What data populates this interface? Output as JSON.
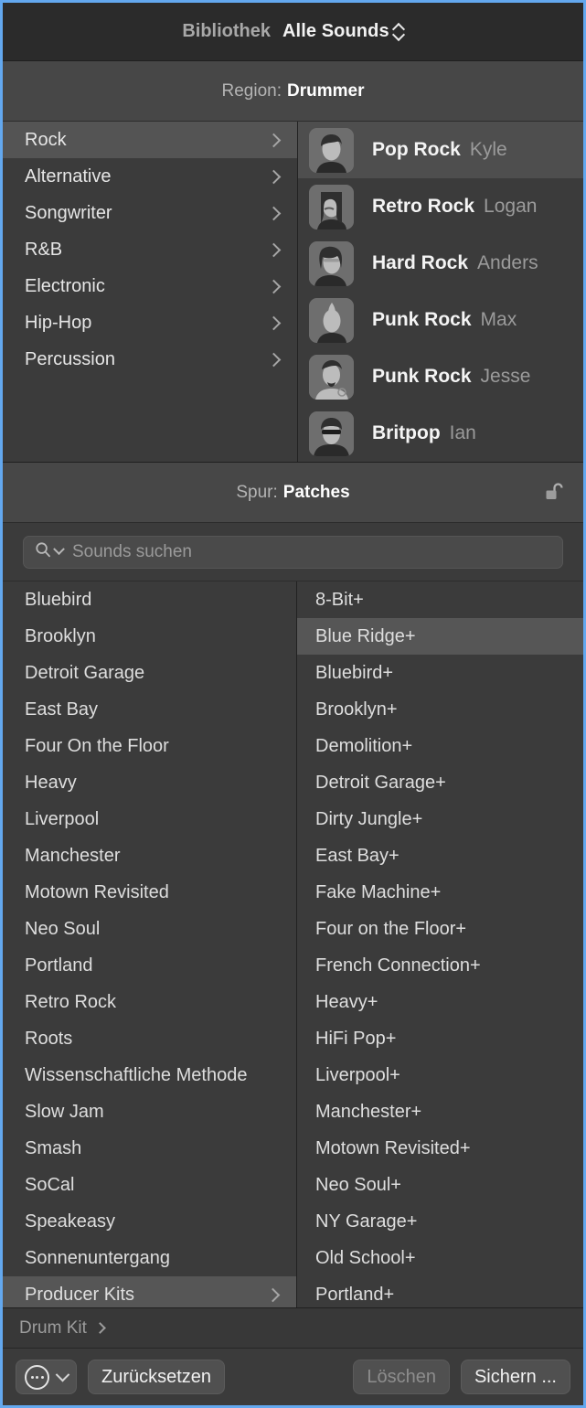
{
  "titlebar": {
    "library_label": "Bibliothek",
    "scope_label": "Alle Sounds",
    "scope_icon": "up-down-chevron-icon"
  },
  "region_header": {
    "prefix": "Region:",
    "value": "Drummer"
  },
  "genres": [
    {
      "label": "Rock",
      "selected": true
    },
    {
      "label": "Alternative",
      "selected": false
    },
    {
      "label": "Songwriter",
      "selected": false
    },
    {
      "label": "R&B",
      "selected": false
    },
    {
      "label": "Electronic",
      "selected": false
    },
    {
      "label": "Hip-Hop",
      "selected": false
    },
    {
      "label": "Percussion",
      "selected": false
    }
  ],
  "drummers": [
    {
      "style": "Pop Rock",
      "name": "Kyle",
      "selected": true,
      "avatar": "avatar-kyle"
    },
    {
      "style": "Retro Rock",
      "name": "Logan",
      "selected": false,
      "avatar": "avatar-logan"
    },
    {
      "style": "Hard Rock",
      "name": "Anders",
      "selected": false,
      "avatar": "avatar-anders"
    },
    {
      "style": "Punk Rock",
      "name": "Max",
      "selected": false,
      "avatar": "avatar-max"
    },
    {
      "style": "Punk Rock",
      "name": "Jesse",
      "selected": false,
      "avatar": "avatar-jesse"
    },
    {
      "style": "Britpop",
      "name": "Ian",
      "selected": false,
      "avatar": "avatar-ian"
    }
  ],
  "track_header": {
    "prefix": "Spur:",
    "value": "Patches",
    "lock_icon": "unlocked-padlock-icon"
  },
  "search": {
    "placeholder": "Sounds suchen",
    "value": "",
    "icon": "search-icon",
    "menu_icon": "chevron-down-icon"
  },
  "patches_left": [
    {
      "label": "Bluebird",
      "selected": false,
      "has_submenu": false
    },
    {
      "label": "Brooklyn",
      "selected": false,
      "has_submenu": false
    },
    {
      "label": "Detroit Garage",
      "selected": false,
      "has_submenu": false
    },
    {
      "label": "East Bay",
      "selected": false,
      "has_submenu": false
    },
    {
      "label": "Four On the Floor",
      "selected": false,
      "has_submenu": false
    },
    {
      "label": "Heavy",
      "selected": false,
      "has_submenu": false
    },
    {
      "label": "Liverpool",
      "selected": false,
      "has_submenu": false
    },
    {
      "label": "Manchester",
      "selected": false,
      "has_submenu": false
    },
    {
      "label": "Motown Revisited",
      "selected": false,
      "has_submenu": false
    },
    {
      "label": "Neo Soul",
      "selected": false,
      "has_submenu": false
    },
    {
      "label": "Portland",
      "selected": false,
      "has_submenu": false
    },
    {
      "label": "Retro Rock",
      "selected": false,
      "has_submenu": false
    },
    {
      "label": "Roots",
      "selected": false,
      "has_submenu": false
    },
    {
      "label": "Wissenschaftliche Methode",
      "selected": false,
      "has_submenu": false
    },
    {
      "label": "Slow Jam",
      "selected": false,
      "has_submenu": false
    },
    {
      "label": "Smash",
      "selected": false,
      "has_submenu": false
    },
    {
      "label": "SoCal",
      "selected": false,
      "has_submenu": false
    },
    {
      "label": "Speakeasy",
      "selected": false,
      "has_submenu": false
    },
    {
      "label": "Sonnenuntergang",
      "selected": false,
      "has_submenu": false
    },
    {
      "label": "Producer Kits",
      "selected": true,
      "has_submenu": true
    }
  ],
  "patches_right": [
    {
      "label": "8-Bit+",
      "selected": false
    },
    {
      "label": "Blue Ridge+",
      "selected": true
    },
    {
      "label": "Bluebird+",
      "selected": false
    },
    {
      "label": "Brooklyn+",
      "selected": false
    },
    {
      "label": "Demolition+",
      "selected": false
    },
    {
      "label": "Detroit Garage+",
      "selected": false
    },
    {
      "label": "Dirty Jungle+",
      "selected": false
    },
    {
      "label": "East Bay+",
      "selected": false
    },
    {
      "label": "Fake Machine+",
      "selected": false
    },
    {
      "label": "Four on the Floor+",
      "selected": false
    },
    {
      "label": "French Connection+",
      "selected": false
    },
    {
      "label": "Heavy+",
      "selected": false
    },
    {
      "label": "HiFi Pop+",
      "selected": false
    },
    {
      "label": "Liverpool+",
      "selected": false
    },
    {
      "label": "Manchester+",
      "selected": false
    },
    {
      "label": "Motown Revisited+",
      "selected": false
    },
    {
      "label": "Neo Soul+",
      "selected": false
    },
    {
      "label": "NY Garage+",
      "selected": false
    },
    {
      "label": "Old School+",
      "selected": false
    },
    {
      "label": "Portland+",
      "selected": false
    }
  ],
  "breadcrumb": {
    "label": "Drum Kit",
    "chevron_icon": "chevron-right-icon"
  },
  "footer": {
    "action_menu_icon": "ellipsis-circle-icon",
    "action_menu_chevron": "chevron-down-icon",
    "reset_label": "Zurücksetzen",
    "delete_label": "Löschen",
    "delete_disabled": true,
    "save_label": "Sichern ..."
  },
  "colors": {
    "window_border": "#63a8ef",
    "titlebar_bg": "#2b2b2b",
    "section_head_bg": "#474747",
    "panel_bg": "#3b3b3b",
    "row_selected": "#565656",
    "text_primary": "#e6e6e6",
    "text_secondary": "#9b9b9b"
  }
}
